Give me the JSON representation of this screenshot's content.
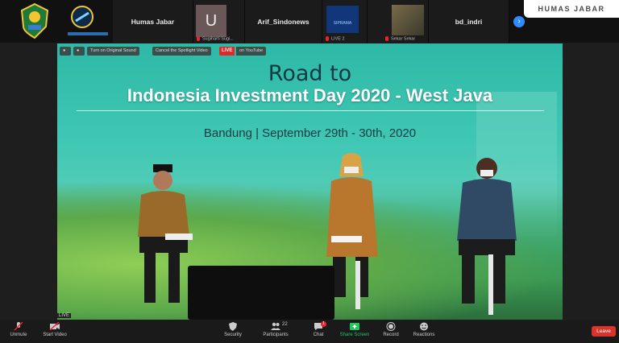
{
  "brand": {
    "label": "HUMAS JABAR"
  },
  "participants_strip": [
    {
      "name": "Humas Jabar"
    },
    {
      "avatar_letter": "U",
      "name": "Sugiharti Sugi..."
    },
    {
      "name": "Arif_Sindonews"
    },
    {
      "logo_text": "SIPRAMA",
      "name": "LIVE 2"
    },
    {
      "name": "Sekar Sekar"
    },
    {
      "name": "bd_indri"
    }
  ],
  "video_controls": {
    "original_sound": "Turn on Original Sound",
    "spotlight": "Cancel the Spotlight Video",
    "live": "LIVE",
    "on_youtube": "on YouTube"
  },
  "banner": {
    "line1": "Road to",
    "line2": "Indonesia Investment Day 2020 - West Java",
    "line3": "Bandung | September 29th - 30th, 2020"
  },
  "live_badge": "LIVE",
  "toolbar": {
    "unmute": "Unmute",
    "start_video": "Start Video",
    "security": "Security",
    "participants": "Participants",
    "participants_count": "22",
    "chat": "Chat",
    "chat_badge": "1",
    "share_screen": "Share Screen",
    "record": "Record",
    "reactions": "Reactions",
    "leave": "Leave"
  },
  "colors": {
    "leave": "#d9342b",
    "share_green": "#22c55e",
    "accent_blue": "#2d8cff"
  }
}
